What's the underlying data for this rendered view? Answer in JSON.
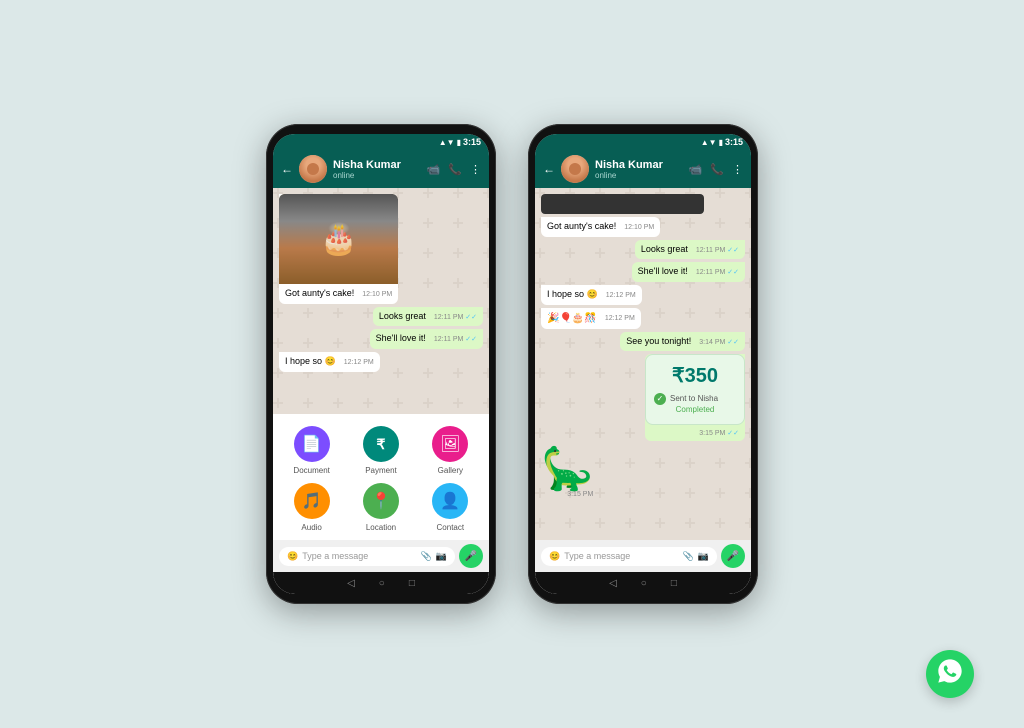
{
  "background_color": "#dce8e8",
  "phone1": {
    "status_bar": {
      "time": "3:15",
      "signal_icon": "▲",
      "wifi_icon": "▼",
      "battery_icon": "▮"
    },
    "header": {
      "contact_name": "Nisha Kumar",
      "contact_status": "online",
      "back_label": "←",
      "video_icon": "📹",
      "call_icon": "📞",
      "more_icon": "⋮"
    },
    "messages": [
      {
        "type": "incoming_with_image",
        "text": "Got aunty's cake!",
        "time": "12:10 PM"
      },
      {
        "type": "outgoing",
        "text": "Looks great",
        "time": "12:11 PM",
        "ticks": "✓✓"
      },
      {
        "type": "outgoing",
        "text": "She'll love it!",
        "time": "12:11 PM",
        "ticks": "✓✓"
      },
      {
        "type": "incoming",
        "text": "I hope so 😊",
        "time": "12:12 PM"
      }
    ],
    "attach_menu": {
      "items": [
        {
          "id": "document",
          "label": "Document",
          "icon": "📄",
          "color": "icon-document"
        },
        {
          "id": "payment",
          "label": "Payment",
          "icon": "₹",
          "color": "icon-payment"
        },
        {
          "id": "gallery",
          "label": "Gallery",
          "icon": "🖼",
          "color": "icon-gallery"
        },
        {
          "id": "audio",
          "label": "Audio",
          "icon": "🎵",
          "color": "icon-audio"
        },
        {
          "id": "location",
          "label": "Location",
          "icon": "📍",
          "color": "icon-location"
        },
        {
          "id": "contact",
          "label": "Contact",
          "icon": "👤",
          "color": "icon-contact"
        }
      ]
    },
    "input_bar": {
      "placeholder": "Type a message",
      "emoji_icon": "😊",
      "attach_icon": "📎",
      "camera_icon": "📷",
      "mic_icon": "🎤"
    },
    "nav": {
      "back": "◁",
      "home": "○",
      "recent": "□"
    }
  },
  "phone2": {
    "status_bar": {
      "time": "3:15"
    },
    "header": {
      "contact_name": "Nisha Kumar",
      "contact_status": "online"
    },
    "messages": [
      {
        "type": "incoming_dark",
        "text": ""
      },
      {
        "type": "incoming",
        "text": "Got aunty's cake!",
        "time": "12:10 PM"
      },
      {
        "type": "outgoing",
        "text": "Looks great",
        "time": "12:11 PM",
        "ticks": "✓✓"
      },
      {
        "type": "outgoing",
        "text": "She'll love it!",
        "time": "12:11 PM",
        "ticks": "✓✓"
      },
      {
        "type": "incoming",
        "text": "I hope so 😊",
        "time": "12:12 PM"
      },
      {
        "type": "incoming_emoji",
        "text": "🎉🎈🎂🎊",
        "time": "12:12 PM"
      },
      {
        "type": "outgoing",
        "text": "See you tonight!",
        "time": "3:14 PM",
        "ticks": "✓✓"
      },
      {
        "type": "payment",
        "amount": "₹350",
        "sent_to": "Sent to Nisha",
        "status": "Completed",
        "time": "3:15 PM",
        "ticks": "✓✓"
      },
      {
        "type": "sticker",
        "emoji": "🦕",
        "time": "3:15 PM"
      }
    ],
    "input_bar": {
      "placeholder": "Type a message",
      "emoji_icon": "😊",
      "attach_icon": "📎",
      "camera_icon": "📷",
      "mic_icon": "🎤"
    },
    "nav": {
      "back": "◁",
      "home": "○",
      "recent": "□"
    }
  },
  "wa_logo": {
    "icon": "💬"
  }
}
